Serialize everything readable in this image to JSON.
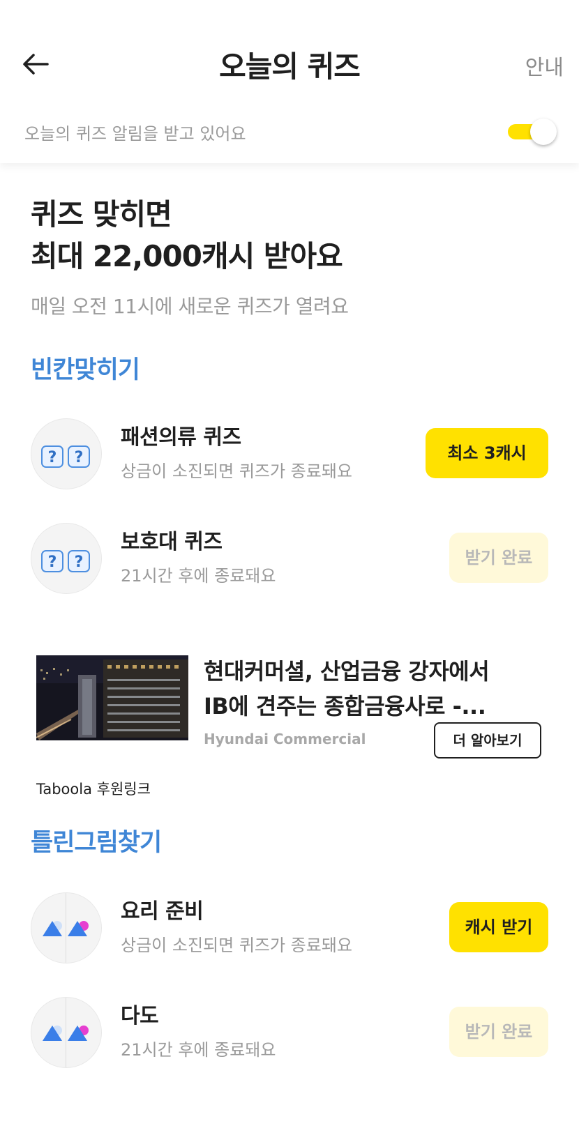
{
  "header": {
    "title": "오늘의 퀴즈",
    "info_label": "안내",
    "notification_text": "오늘의 퀴즈 알림을 받고 있어요",
    "notification_on": true
  },
  "hero": {
    "title_line1": "퀴즈 맞히면",
    "title_line2": "최대 22,000캐시 받아요",
    "subtitle": "매일 오전 11시에 새로운 퀴즈가 열려요"
  },
  "sections": [
    {
      "title": "빈칸맞히기",
      "items": [
        {
          "title": "패션의류 퀴즈",
          "subtitle": "상금이 소진되면 퀴즈가 종료돼요",
          "button": "최소 3캐시",
          "state": "active"
        },
        {
          "title": "보호대 퀴즈",
          "subtitle": "21시간 후에 종료돼요",
          "button": "받기 완료",
          "state": "done"
        }
      ]
    },
    {
      "title": "틀린그림찾기",
      "items": [
        {
          "title": "요리 준비",
          "subtitle": "상금이 소진되면 퀴즈가 종료돼요",
          "button": "캐시 받기",
          "state": "active"
        },
        {
          "title": "다도",
          "subtitle": "21시간 후에 종료돼요",
          "button": "받기 완료",
          "state": "done"
        }
      ]
    }
  ],
  "ad": {
    "headline_line1": "현대커머셜, 산업금융 강자에서",
    "headline_line2": "IB에 견주는 종합금융사로 -...",
    "source": "Hyundai Commercial",
    "cta": "더 알아보기",
    "sponsor_label": "Taboola 후원링크"
  },
  "colors": {
    "accent_yellow": "#ffe100",
    "section_blue": "#3f86d6",
    "done_bg": "#fff9d9"
  },
  "icons": [
    "back-arrow-icon",
    "question-box-icon",
    "spot-difference-icon"
  ]
}
